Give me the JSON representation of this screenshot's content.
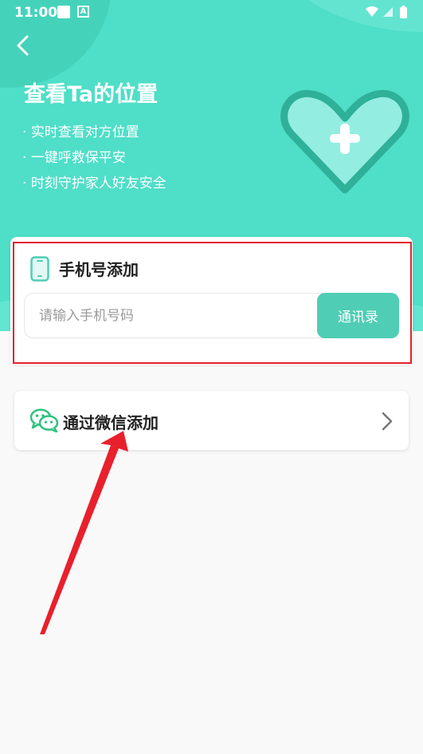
{
  "status_bar": {
    "time": "11:00"
  },
  "hero": {
    "title": "查看Ta的位置",
    "features": [
      "实时查看对方位置",
      "一键呼救保平安",
      "时刻守护家人好友安全"
    ]
  },
  "phone_card": {
    "title": "手机号添加",
    "placeholder": "请输入手机号码",
    "contacts_button": "通讯录"
  },
  "wechat_card": {
    "label": "通过微信添加"
  },
  "colors": {
    "primary": "#4fdec8",
    "button": "#4fcdb5",
    "highlight": "#e2202b",
    "arrow": "#e8202c"
  }
}
